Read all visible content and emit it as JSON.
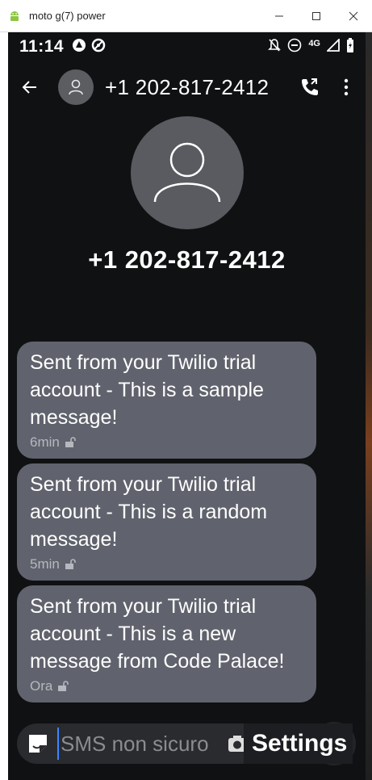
{
  "window": {
    "title": "moto g(7) power"
  },
  "statusbar": {
    "time": "11:14",
    "network": "4G"
  },
  "appbar": {
    "title": "+1 202-817-2412"
  },
  "contact": {
    "name": "+1 202-817-2412"
  },
  "messages": [
    {
      "text": "Sent from your Twilio trial account - This is a sample message!",
      "time": "6min"
    },
    {
      "text": "Sent from your Twilio trial account - This is a random message!",
      "time": "5min"
    },
    {
      "text": "Sent from your Twilio trial account - This is a new message from Code Palace!",
      "time": "Ora"
    }
  ],
  "composer": {
    "placeholder": "SMS non sicuro"
  },
  "overlay": {
    "settings_label": "Settings"
  },
  "colors": {
    "background": "#101112",
    "bubble": "#60636d",
    "avatar": "#595b60",
    "composer": "#2a2b2f"
  }
}
